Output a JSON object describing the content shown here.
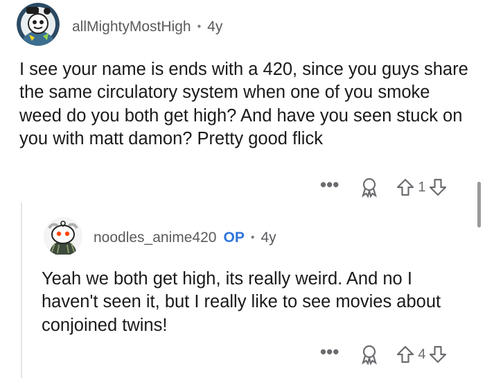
{
  "comment": {
    "username": "allMightyMostHigh",
    "separator": "•",
    "age": "4y",
    "text": "I see your  name is ends with a 420, since you guys share the same circulatory system when one of you smoke weed do you both get high? And have you seen stuck on you with matt damon? Pretty good flick",
    "more_label": "•••",
    "vote_count": "1"
  },
  "reply": {
    "username": "noodles_anime420",
    "op_badge": "OP",
    "separator": "•",
    "age": "4y",
    "text": "Yeah we both get high, its really weird. And no I haven't seen it, but I really like to see movies about conjoined twins!",
    "more_label": "•••",
    "vote_count": "4"
  },
  "icons": {
    "award": "award-icon",
    "upvote": "upvote-arrow-icon",
    "downvote": "downvote-arrow-icon",
    "more": "more-options-icon"
  },
  "colors": {
    "text": "#1a1a1b",
    "meta": "#57595c",
    "op_badge": "#0b5ed7",
    "thread_line": "#e3e4e6"
  }
}
